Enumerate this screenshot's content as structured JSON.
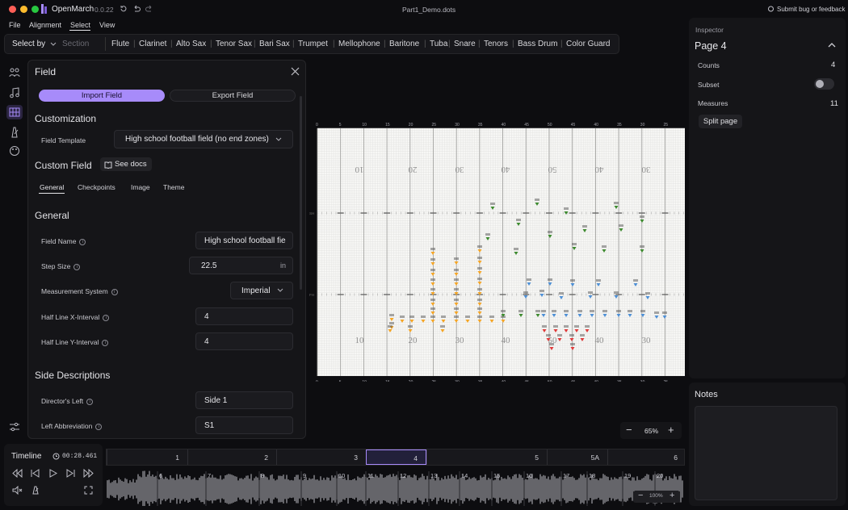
{
  "app": {
    "name": "OpenMarch",
    "version": "0.0.22",
    "file": "Part1_Demo.dots",
    "feedback": "Submit bug or feedback"
  },
  "menu": [
    "File",
    "Alignment",
    "Select",
    "View"
  ],
  "toolbar": {
    "select_by": "Select by",
    "section_placeholder": "Section",
    "sections": [
      "Flute",
      "Clarinet",
      "Alto Sax",
      "Tenor Sax",
      "Bari Sax",
      "Trumpet",
      "Mellophone",
      "Baritone",
      "Tuba",
      "Snare",
      "Tenors",
      "Bass Drum",
      "Color Guard"
    ]
  },
  "panel": {
    "title": "Field",
    "import": "Import Field",
    "export": "Export Field",
    "customization": "Customization",
    "field_template_label": "Field Template",
    "field_template_value": "High school football field (no end zones)",
    "custom_field": "Custom Field",
    "see_docs": "See docs",
    "tabs": [
      "General",
      "Checkpoints",
      "Image",
      "Theme"
    ],
    "general": "General",
    "field_name_label": "Field Name",
    "field_name_value": "High school football fie",
    "step_size_label": "Step Size",
    "step_size_value": "22.5",
    "step_size_unit": "in",
    "measurement_label": "Measurement System",
    "measurement_value": "Imperial",
    "half_x_label": "Half Line X-Interval",
    "half_x_value": "4",
    "half_y_label": "Half Line Y-Interval",
    "half_y_value": "4",
    "side_desc": "Side Descriptions",
    "directors_left_label": "Director's Left",
    "directors_left_value": "Side 1",
    "left_abbr_label": "Left Abbreviation",
    "left_abbr_value": "S1"
  },
  "field": {
    "top_ticks": [
      "0",
      "5",
      "10",
      "15",
      "20",
      "25",
      "30",
      "35",
      "40",
      "45",
      "50",
      "45",
      "40",
      "35",
      "30",
      "25"
    ],
    "bottom_ticks": [
      "0",
      "5",
      "10",
      "15",
      "20",
      "25",
      "30",
      "35",
      "40",
      "45",
      "50",
      "45",
      "40",
      "35",
      "30",
      "25"
    ],
    "top_numbers": [
      "10",
      "20",
      "30",
      "40",
      "50",
      "40",
      "30"
    ],
    "bottom_numbers": [
      "10",
      "20",
      "30",
      "40",
      "50",
      "40",
      "30"
    ],
    "hash_labels": [
      "SH",
      "FH"
    ],
    "zoom": "65%"
  },
  "inspector": {
    "title": "Inspector",
    "page": "Page 4",
    "counts_label": "Counts",
    "counts": "4",
    "subset_label": "Subset",
    "measures_label": "Measures",
    "measures": "11",
    "split": "Split page"
  },
  "notes": {
    "title": "Notes"
  },
  "timeline": {
    "title": "Timeline",
    "time": "00:28.461",
    "pages": [
      "1",
      "2",
      "3",
      "4",
      "5",
      "5A",
      "6"
    ],
    "measures": [
      "6",
      "7",
      "8",
      "9",
      "10",
      "11",
      "12",
      "13",
      "14",
      "15",
      "16",
      "17",
      "18",
      "19",
      "20"
    ],
    "audio_zoom": "100%"
  },
  "colors": {
    "accent": "#a78bfa",
    "woodwind": "#f5a524",
    "brass": "#3c8a2e",
    "battery": "#4c8fd6",
    "guard": "#e03a3a"
  }
}
